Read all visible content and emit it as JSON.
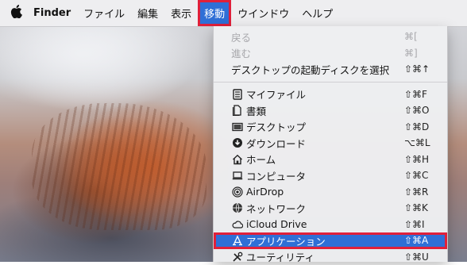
{
  "menubar": {
    "apple_icon": "apple-logo-icon",
    "items": [
      "Finder",
      "ファイル",
      "編集",
      "表示",
      "移動",
      "ウインドウ",
      "ヘルプ"
    ]
  },
  "menu": {
    "top_items": [
      {
        "label": "戻る",
        "shortcut": "⌘[",
        "enabled": false
      },
      {
        "label": "進む",
        "shortcut": "⌘]",
        "enabled": false
      },
      {
        "label": "デスクトップの起動ディスクを選択",
        "shortcut": "⇧⌘↑",
        "enabled": true
      }
    ],
    "places": [
      {
        "label": "マイファイル",
        "shortcut": "⇧⌘F",
        "icon": "all-my-files-icon"
      },
      {
        "label": "書類",
        "shortcut": "⇧⌘O",
        "icon": "documents-icon"
      },
      {
        "label": "デスクトップ",
        "shortcut": "⇧⌘D",
        "icon": "desktop-icon"
      },
      {
        "label": "ダウンロード",
        "shortcut": "⌥⌘L",
        "icon": "downloads-icon"
      },
      {
        "label": "ホーム",
        "shortcut": "⇧⌘H",
        "icon": "home-icon"
      },
      {
        "label": "コンピュータ",
        "shortcut": "⇧⌘C",
        "icon": "computer-icon"
      },
      {
        "label": "AirDrop",
        "shortcut": "⇧⌘R",
        "icon": "airdrop-icon"
      },
      {
        "label": "ネットワーク",
        "shortcut": "⇧⌘K",
        "icon": "network-icon"
      },
      {
        "label": "iCloud Drive",
        "shortcut": "⇧⌘I",
        "icon": "icloud-icon"
      },
      {
        "label": "アプリケーション",
        "shortcut": "⇧⌘A",
        "icon": "applications-icon",
        "selected": true
      },
      {
        "label": "ユーティリティ",
        "shortcut": "⇧⌘U",
        "icon": "utilities-icon"
      }
    ]
  },
  "colors": {
    "highlight": "#2f6fd6",
    "annotation_outline": "#e0203a"
  }
}
